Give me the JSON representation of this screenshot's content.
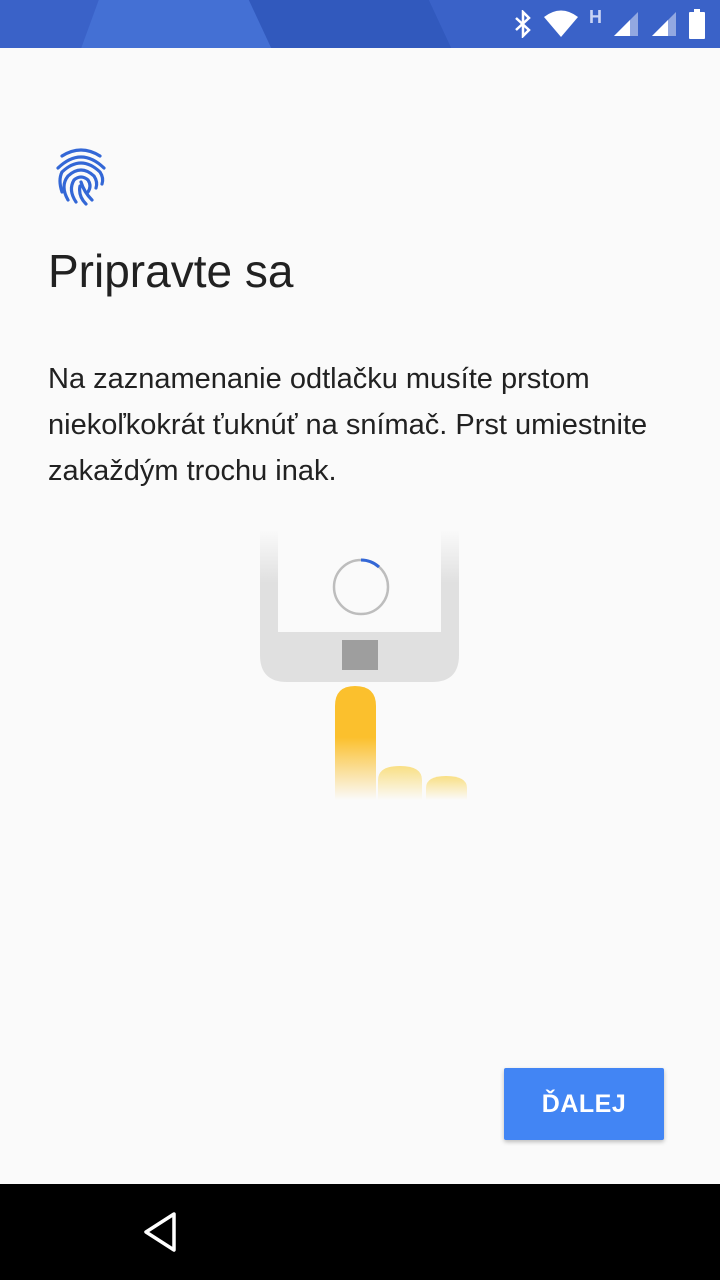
{
  "status_bar": {
    "background": "#3a62c8",
    "network_type": "H",
    "icons": [
      "bluetooth-icon",
      "wifi-icon",
      "cell-signal-icon",
      "cell-signal-icon",
      "battery-icon"
    ]
  },
  "header": {
    "icon": "fingerprint-icon",
    "icon_color": "#3367d6"
  },
  "title": "Pripravte sa",
  "description": "Na zaznamenanie odtlačku musíte prstom niekoľkokrát ťuknúť na snímač. Prst umiestnite zakaždým trochu inak.",
  "illustration": {
    "phone_sensor": "fingerprint-sensor-illustration",
    "finger_color": "#fbc02d"
  },
  "actions": {
    "next_label": "ĎALEJ",
    "accent": "#4285f4"
  },
  "nav": {
    "back_icon": "back-triangle-icon"
  }
}
